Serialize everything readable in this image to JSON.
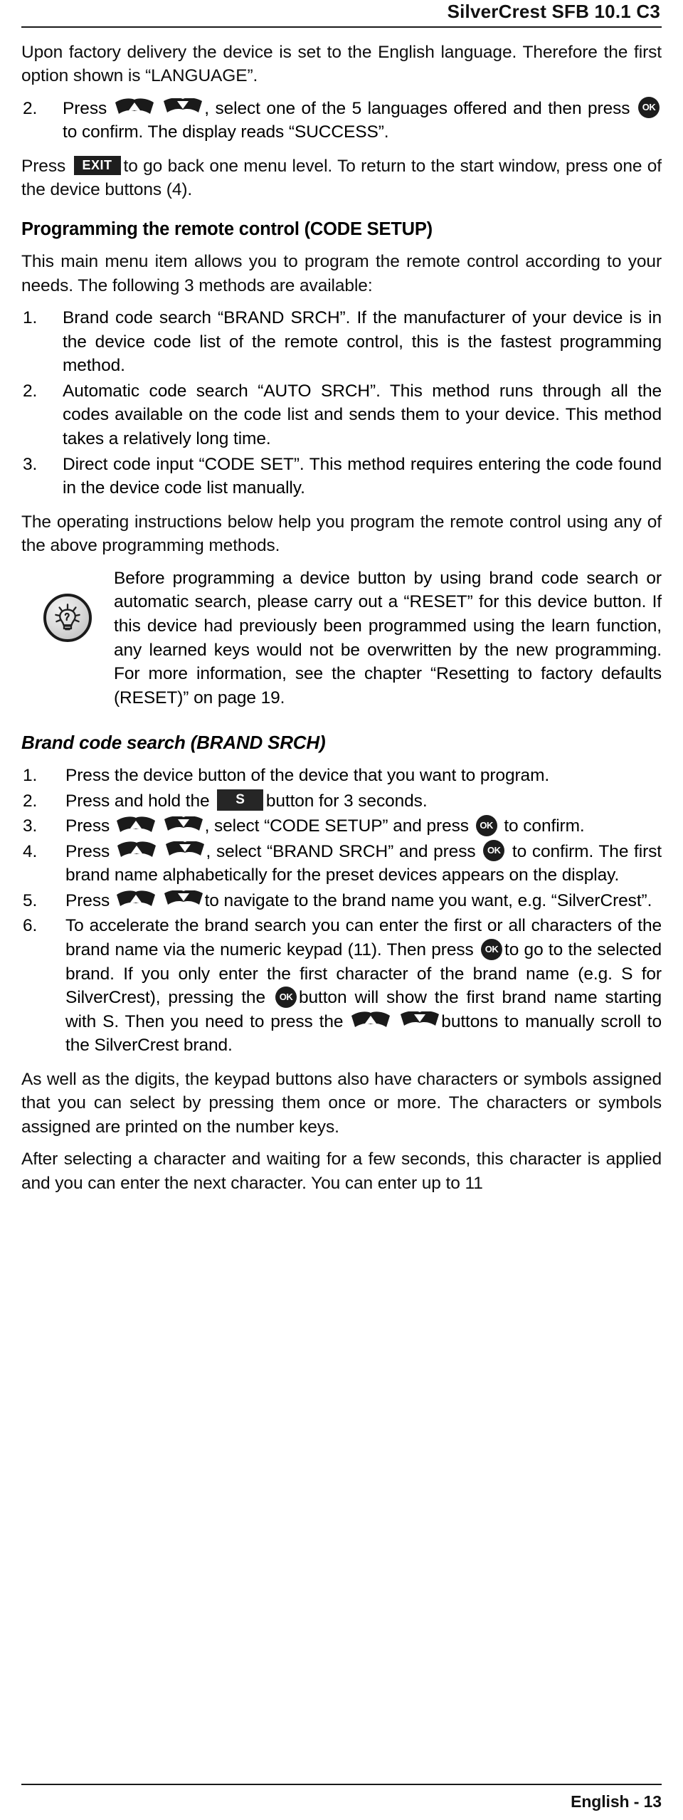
{
  "header": {
    "title": "SilverCrest SFB 10.1 C3"
  },
  "icons": {
    "arrow_up": "arrow-up-key-icon",
    "arrow_down": "arrow-down-key-icon",
    "ok": "OK",
    "exit": "EXIT",
    "s_button": "S",
    "bulb": "lightbulb-tip-icon"
  },
  "intro": {
    "line1": "Upon factory delivery the device is set to the English language. Therefore the first option shown is “LANGUAGE”.",
    "step2": {
      "number": "2.",
      "t1": "Press",
      "t2": ", select one of the 5 languages offered and then press",
      "t3": "to confirm. The display reads “SUCCESS”."
    },
    "exit_para": {
      "t1": "Press",
      "t2": "to go back one menu level. To return to the start window, press one of the device buttons (4)."
    }
  },
  "code_setup": {
    "heading": "Programming the remote control (CODE SETUP)",
    "intro": "This main menu item allows you to program the remote control according to your needs. The following 3 methods are available:",
    "methods": [
      {
        "number": "1.",
        "text": "Brand code search “BRAND SRCH”. If the manufacturer of your device is in the device code list of the remote control, this is the fastest programming method."
      },
      {
        "number": "2.",
        "text": "Automatic code search “AUTO SRCH”. This method runs through all the codes available on the code list and sends them to your device. This method takes a relatively long time."
      },
      {
        "number": "3.",
        "text": "Direct code input “CODE SET”. This method requires entering the code found in the device code list manually."
      }
    ],
    "closing": "The operating instructions below help you program the remote control using any of the above programming methods."
  },
  "tip": {
    "text": "Before programming a device button by using brand code search or automatic search, please carry out a “RESET” for this device button. If this device had previously been programmed using the learn function, any learned keys would not be overwritten by the new programming. For more information, see the chapter “Resetting to factory defaults (RESET)” on page 19."
  },
  "brand_search": {
    "heading": "Brand code search (BRAND SRCH)",
    "steps": [
      {
        "number": "1.",
        "t1": "Press the device button of the device that you want to program."
      },
      {
        "number": "2.",
        "t1": "Press and hold the",
        "t2": "button for 3 seconds."
      },
      {
        "number": "3.",
        "t1": "Press",
        "t2": ", select “CODE SETUP” and press",
        "t3": "to confirm."
      },
      {
        "number": "4.",
        "t1": "Press",
        "t2": ", select “BRAND SRCH” and press",
        "t3": "to confirm. The first brand name alphabetically for the preset devices appears on the display."
      },
      {
        "number": "5.",
        "t1": "Press",
        "t2": "to navigate to the brand name you want, e.g. “SilverCrest”."
      },
      {
        "number": "6.",
        "t1": "To accelerate the brand search you can enter the first or all characters of the brand name via the numeric keypad (11). Then press",
        "t2": "to go to the selected brand. If you only enter the first character of the brand name (e.g. S for SilverCrest), pressing the",
        "t3": "button will show the first brand name starting with S. Then you need to press the",
        "t4": "buttons to manually scroll to the SilverCrest brand."
      }
    ],
    "closing1": "As well as the digits, the keypad buttons also have characters or symbols assigned that you can select by pressing them once or more. The characters or symbols assigned are printed on the number keys.",
    "closing2": "After selecting a character and waiting for a few seconds, this character is applied and you can enter the next character. You can enter up to 11"
  },
  "footer": {
    "text": "English - 13"
  }
}
